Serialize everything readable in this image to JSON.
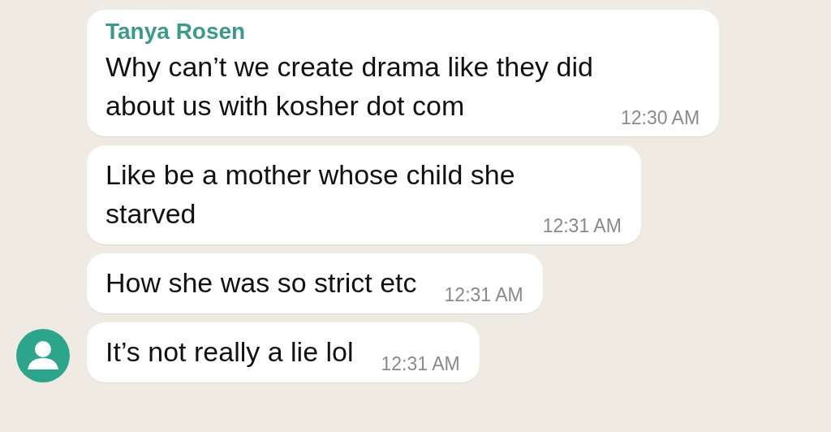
{
  "messages": [
    {
      "sender": "Tanya Rosen",
      "text": "Why can’t we create drama like they did\nabout us with kosher dot com",
      "time": "12:30 AM",
      "avatar": false
    },
    {
      "text": "Like be a mother whose child she\nstarved",
      "time": "12:31 AM",
      "avatar": false
    },
    {
      "text": "How she was so strict etc",
      "time": "12:31 AM",
      "avatar": false
    },
    {
      "text": "It’s not really a lie lol",
      "time": "12:31 AM",
      "avatar": true
    }
  ]
}
